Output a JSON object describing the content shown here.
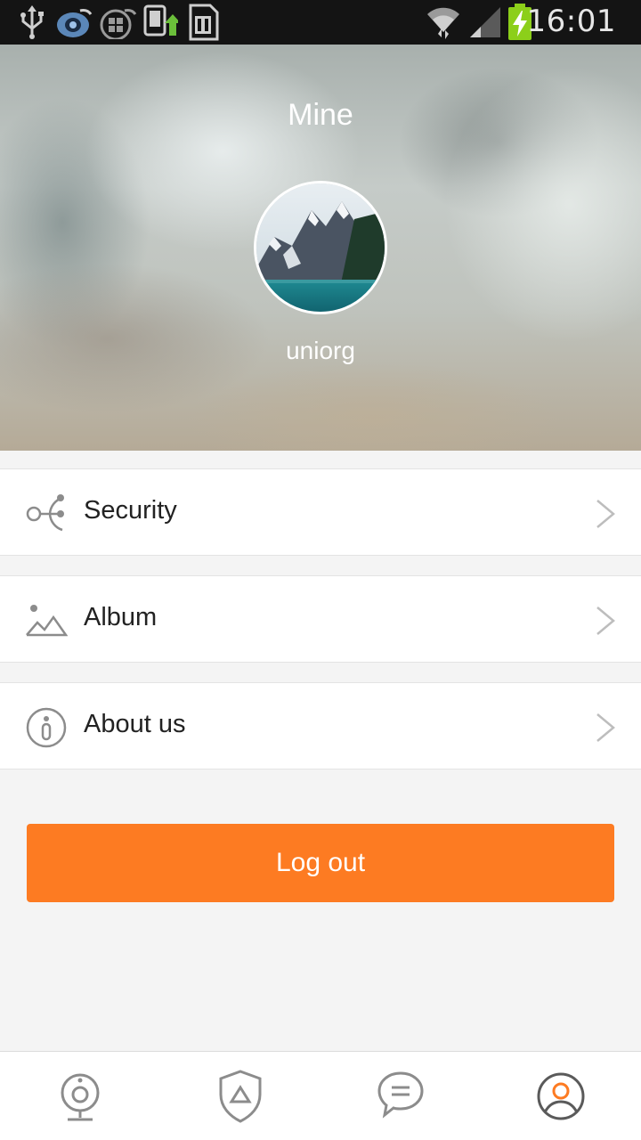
{
  "status_bar": {
    "time": "16:01",
    "icons": [
      "usb-icon",
      "app-icon",
      "app2-icon",
      "download-icon",
      "sd-card-icon",
      "wifi-icon",
      "signal-icon",
      "battery-charging-icon"
    ]
  },
  "header": {
    "title": "Mine",
    "username": "uniorg",
    "avatar_icon": "mountain-lake-avatar"
  },
  "menu": {
    "items": [
      {
        "label": "Security",
        "icon": "share-nodes-icon"
      },
      {
        "label": "Album",
        "icon": "landscape-icon"
      },
      {
        "label": "About us",
        "icon": "info-icon"
      }
    ]
  },
  "logout": {
    "label": "Log out"
  },
  "bottom_nav": {
    "items": [
      {
        "icon": "camera-icon",
        "active": false
      },
      {
        "icon": "shield-icon",
        "active": false
      },
      {
        "icon": "message-icon",
        "active": false
      },
      {
        "icon": "profile-icon",
        "active": true
      }
    ]
  },
  "colors": {
    "accent": "#fd7b22",
    "status_bar": "#141414",
    "icon_gray": "#8c8c8c"
  }
}
